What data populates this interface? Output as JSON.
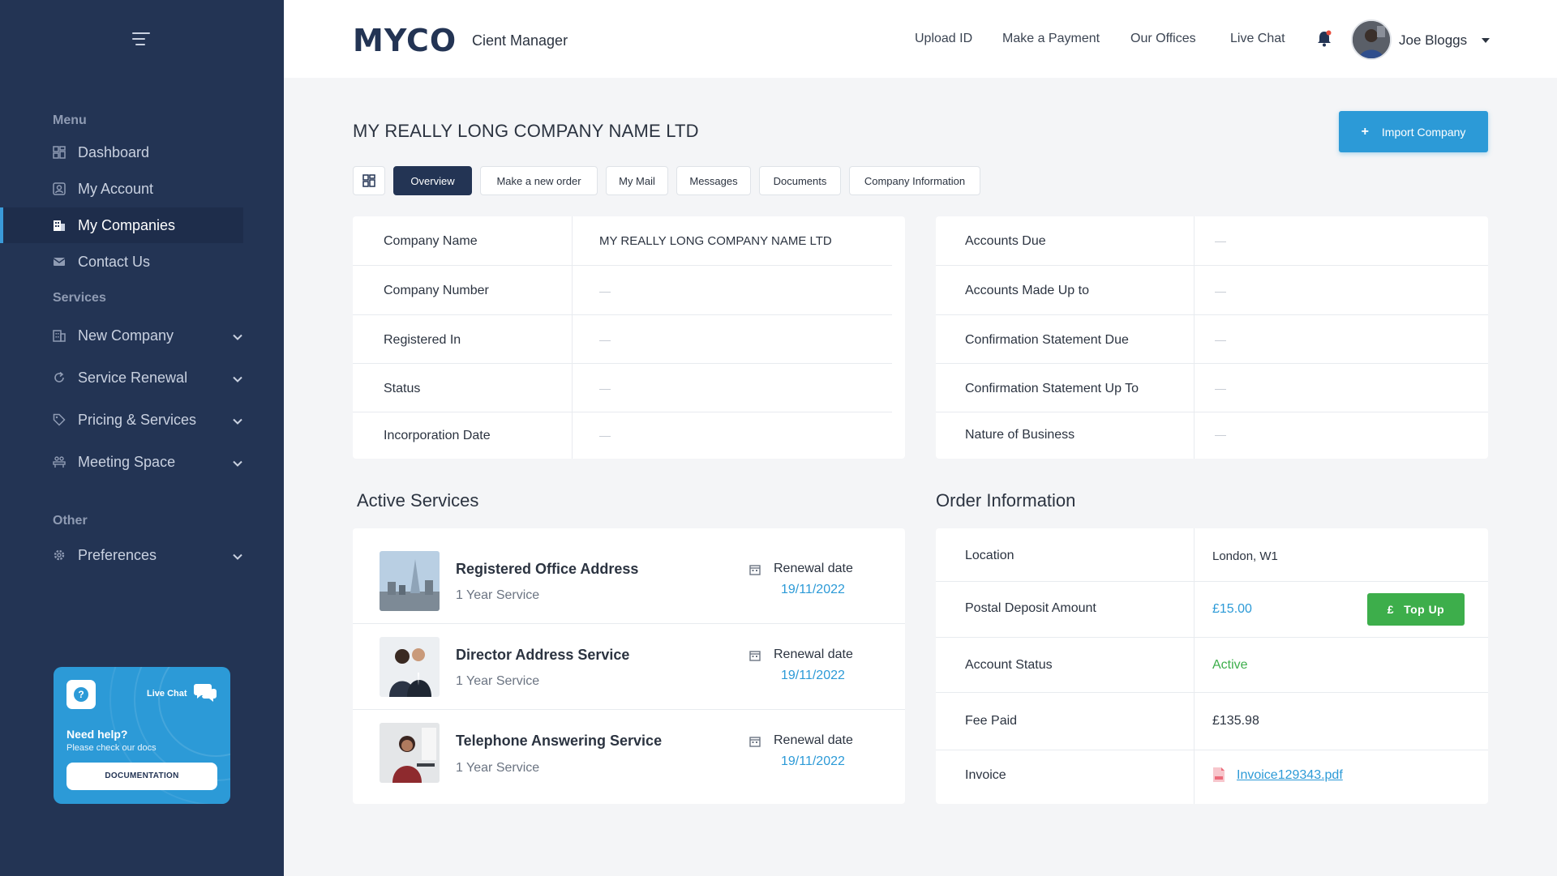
{
  "sidebar": {
    "menu_heading": "Menu",
    "services_heading": "Services",
    "other_heading": "Other",
    "menu_items": [
      {
        "label": "Dashboard",
        "icon": "dashboard-icon"
      },
      {
        "label": "My Account",
        "icon": "account-icon"
      },
      {
        "label": "My Companies",
        "icon": "building-icon",
        "active": true
      },
      {
        "label": "Contact Us",
        "icon": "mail-icon"
      }
    ],
    "service_items": [
      {
        "label": "New Company",
        "icon": "building-icon"
      },
      {
        "label": "Service Renewal",
        "icon": "refresh-icon"
      },
      {
        "label": "Pricing & Services",
        "icon": "tag-icon"
      },
      {
        "label": "Meeting Space",
        "icon": "meeting-icon"
      }
    ],
    "other_items": [
      {
        "label": "Preferences",
        "icon": "gear-icon"
      }
    ],
    "help": {
      "live_chat": "Live Chat",
      "title": "Need help?",
      "subtitle": "Please check our docs",
      "button": "DOCUMENTATION"
    }
  },
  "header": {
    "logo": "MYCO",
    "app_title": "Cient Manager",
    "nav": [
      "Upload ID",
      "Make a Payment",
      "Our Offices",
      "Live Chat"
    ],
    "user_name": "Joe Bloggs"
  },
  "page": {
    "company_title": "MY REALLY LONG COMPANY NAME LTD",
    "import_button": "Import Company",
    "tabs": [
      "Overview",
      "Make a new order",
      "My Mail",
      "Messages",
      "Documents",
      "Company Information"
    ],
    "active_tab": "Overview"
  },
  "company_details": [
    {
      "label": "Company Name",
      "value": "MY REALLY LONG COMPANY NAME LTD"
    },
    {
      "label": "Company Number",
      "value": ""
    },
    {
      "label": "Registered In",
      "value": ""
    },
    {
      "label": "Status",
      "value": ""
    },
    {
      "label": "Incorporation Date",
      "value": ""
    }
  ],
  "accounts_details": [
    {
      "label": "Accounts Due",
      "value": ""
    },
    {
      "label": "Accounts Made Up to",
      "value": ""
    },
    {
      "label": "Confirmation Statement Due",
      "value": ""
    },
    {
      "label": "Confirmation Statement Up To",
      "value": ""
    },
    {
      "label": "Nature of Business",
      "value": ""
    }
  ],
  "active_services": {
    "title": "Active Services",
    "items": [
      {
        "name": "Registered Office Address",
        "term": "1 Year Service",
        "renewal_label": "Renewal date",
        "renewal_date": "19/11/2022"
      },
      {
        "name": "Director Address Service",
        "term": "1 Year Service",
        "renewal_label": "Renewal date",
        "renewal_date": "19/11/2022"
      },
      {
        "name": "Telephone Answering Service",
        "term": "1 Year Service",
        "renewal_label": "Renewal date",
        "renewal_date": "19/11/2022"
      }
    ]
  },
  "order_info": {
    "title": "Order Information",
    "location_label": "Location",
    "location_value": "London, W1",
    "deposit_label": "Postal Deposit Amount",
    "deposit_value": "£15.00",
    "topup_button": "Top Up",
    "topup_symbol": "£",
    "status_label": "Account Status",
    "status_value": "Active",
    "fee_label": "Fee Paid",
    "fee_value": "£135.98",
    "invoice_label": "Invoice",
    "invoice_value": "Invoice129343.pdf"
  },
  "colors": {
    "sidebar_bg": "#233454",
    "accent": "#2c9ad7",
    "success": "#3dae4b"
  }
}
